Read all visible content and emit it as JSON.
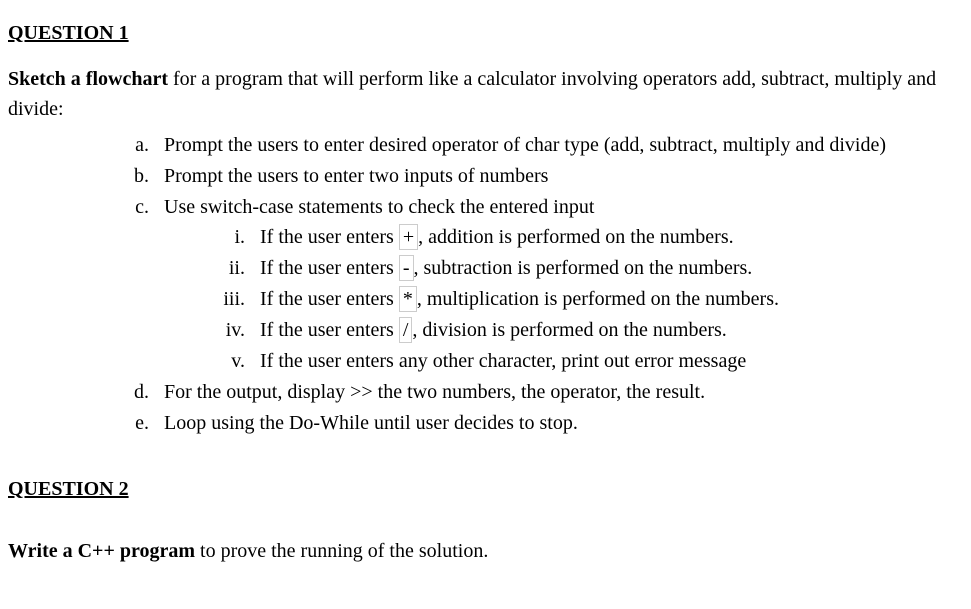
{
  "q1": {
    "heading": "QUESTION 1",
    "intro_bold": "Sketch a flowchart",
    "intro_rest": " for a program that will perform like a calculator involving operators add, subtract, multiply and divide:",
    "items": {
      "a": "Prompt the users to enter desired operator of char type (add, subtract, multiply and divide)",
      "b": "Prompt the users to enter two inputs of numbers",
      "c": "Use switch-case statements to check the entered input",
      "d": "For the output, display >> the two numbers, the operator, the result.",
      "e": "Loop using the Do-While until user decides to stop."
    },
    "roman": {
      "i_pre": "If the user enters ",
      "i_op": "+",
      "i_post": ", addition is performed on the numbers.",
      "ii_pre": "If the user enters ",
      "ii_op": "-",
      "ii_post": ", subtraction is performed on the numbers.",
      "iii_pre": "If the user enters ",
      "iii_op": "*",
      "iii_post": ", multiplication is performed on the numbers.",
      "iv_pre": "If the user enters ",
      "iv_op": "/",
      "iv_post": ", division is performed on the numbers.",
      "v": "If the user enters any other character, print out error message"
    }
  },
  "q2": {
    "heading": "QUESTION 2",
    "body_bold": "Write a C++ program",
    "body_rest": " to prove the running of the solution."
  }
}
